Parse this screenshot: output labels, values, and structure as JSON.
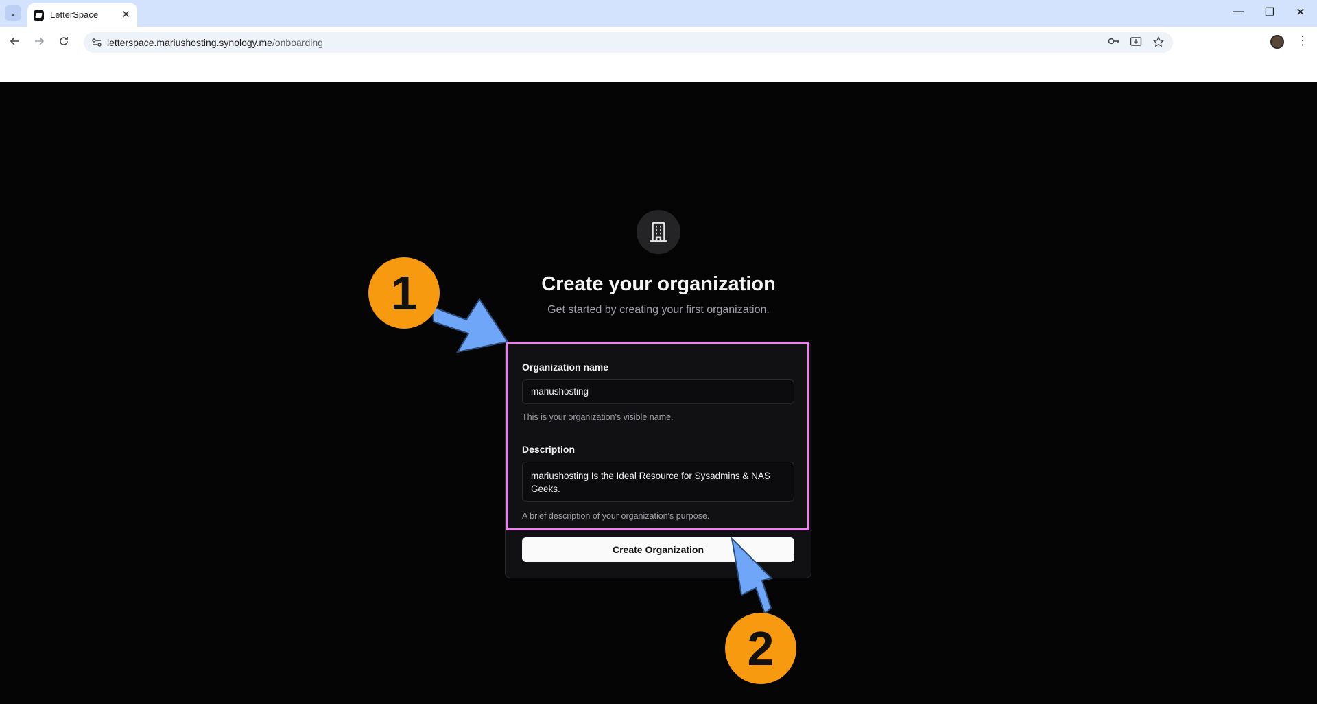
{
  "browser": {
    "tab_title": "LetterSpace",
    "tab_close": "✕",
    "tab_menu": "⌄",
    "url_host": "letterspace.mariushosting.synology.me",
    "url_path": "/onboarding",
    "window_controls": [
      "—",
      "❐",
      "✕"
    ]
  },
  "page": {
    "title": "Create your organization",
    "subtitle": "Get started by creating your first organization.",
    "form": {
      "org_name_label": "Organization name",
      "org_name_value": "mariushosting",
      "org_name_hint": "This is your organization's visible name.",
      "description_label": "Description",
      "description_value": "mariushosting Is the Ideal Resource for Sysadmins & NAS Geeks.",
      "description_hint": "A brief description of your organization's purpose.",
      "submit_label": "Create Organization"
    }
  },
  "annotations": {
    "step1": "1",
    "step2": "2",
    "highlight_color": "#ef7ef0",
    "step_color": "#f89a0f",
    "arrow_color": "#6fa6f7"
  }
}
